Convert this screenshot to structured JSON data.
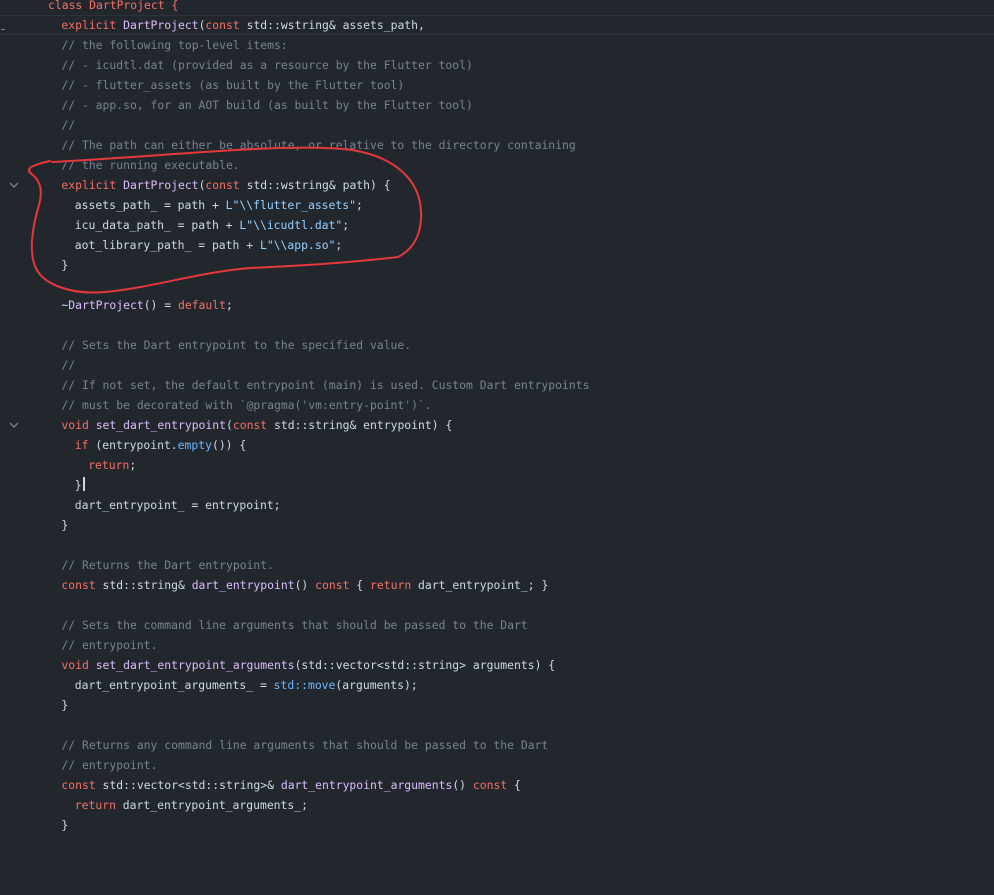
{
  "colors": {
    "background": "#22272e",
    "keyword": "#f47067",
    "function": "#dcbdfb",
    "string": "#96d0ff",
    "comment": "#768390",
    "std_call": "#6cb6ff",
    "plain": "#cdd9e5",
    "annotation_stroke": "#e5383b"
  },
  "icons": {
    "fold": "chevron-down-icon",
    "annotation": "hand-drawn-circle"
  },
  "code": {
    "line0": {
      "t1": "class DartProject {"
    },
    "line1": {
      "t1": "explicit",
      "t2": " ",
      "t3": "DartProject",
      "t4": "(",
      "t5": "const",
      "t6": " std::wstring& assets_path,"
    },
    "line2": {
      "t1": "// the following top-level items:"
    },
    "line3": {
      "t1": "// - icudtl.dat (provided as a resource by the Flutter tool)"
    },
    "line4": {
      "t1": "// - flutter_assets (as built by the Flutter tool)"
    },
    "line5": {
      "t1": "// - app.so, for an AOT build (as built by the Flutter tool)"
    },
    "line6": {
      "t1": "//"
    },
    "line7": {
      "t1": "// The path can either be absolute, or relative to the directory containing"
    },
    "line8": {
      "t1": "// the running executable."
    },
    "line9": {
      "t1": "explicit",
      "t2": " ",
      "t3": "DartProject",
      "t4": "(",
      "t5": "const",
      "t6": " std::wstring& path) {"
    },
    "line10": {
      "t1": "assets_path_ = path + ",
      "t2": "L\"\\\\flutter_assets\"",
      "t3": ";"
    },
    "line11": {
      "t1": "icu_data_path_ = path + ",
      "t2": "L\"\\\\icudtl.dat\"",
      "t3": ";"
    },
    "line12": {
      "t1": "aot_library_path_ = path + ",
      "t2": "L\"\\\\app.so\"",
      "t3": ";"
    },
    "line13": {
      "t1": "}"
    },
    "line14": {
      "t1": ""
    },
    "line15": {
      "t1": "~",
      "t2": "DartProject",
      "t3": "() = ",
      "t4": "default",
      "t5": ";"
    },
    "line16": {
      "t1": ""
    },
    "line17": {
      "t1": "// Sets the Dart entrypoint to the specified value."
    },
    "line18": {
      "t1": "//"
    },
    "line19": {
      "t1": "// If not set, the default entrypoint (main) is used. Custom Dart entrypoints"
    },
    "line20": {
      "t1": "// must be decorated with `@pragma('vm:entry-point')`."
    },
    "line21": {
      "t1": "void",
      "t2": " ",
      "t3": "set_dart_entrypoint",
      "t4": "(",
      "t5": "const",
      "t6": " std::string& entrypoint) {"
    },
    "line22": {
      "t1": "if",
      "t2": " (entrypoint.",
      "t3": "empty",
      "t4": "()) {"
    },
    "line23": {
      "t1": "return",
      "t2": ";"
    },
    "line24": {
      "t1": "}"
    },
    "line25": {
      "t1": "dart_entrypoint_ = entrypoint;"
    },
    "line26": {
      "t1": "}"
    },
    "line27": {
      "t1": ""
    },
    "line28": {
      "t1": "// Returns the Dart entrypoint."
    },
    "line29": {
      "t1": "const",
      "t2": " std::string& ",
      "t3": "dart_entrypoint",
      "t4": "() ",
      "t5": "const",
      "t6": " { ",
      "t7": "return",
      "t8": " dart_entrypoint_; }"
    },
    "line30": {
      "t1": ""
    },
    "line31": {
      "t1": "// Sets the command line arguments that should be passed to the Dart"
    },
    "line32": {
      "t1": "// entrypoint."
    },
    "line33": {
      "t1": "void",
      "t2": " ",
      "t3": "set_dart_entrypoint_arguments",
      "t4": "(std::vector<std::string> arguments) {"
    },
    "line34": {
      "t1": "dart_entrypoint_arguments_ = ",
      "t2": "std::move",
      "t3": "(arguments);"
    },
    "line35": {
      "t1": "}"
    },
    "line36": {
      "t1": ""
    },
    "line37": {
      "t1": "// Returns any command line arguments that should be passed to the Dart"
    },
    "line38": {
      "t1": "// entrypoint."
    },
    "line39": {
      "t1": "const",
      "t2": " std::vector<std::string>& ",
      "t3": "dart_entrypoint_arguments",
      "t4": "() ",
      "t5": "const",
      "t6": " {"
    },
    "line40": {
      "t1": "return",
      "t2": " dart_entrypoint_arguments_;"
    },
    "line41": {
      "t1": "}"
    },
    "line42": {
      "t1": ""
    }
  }
}
